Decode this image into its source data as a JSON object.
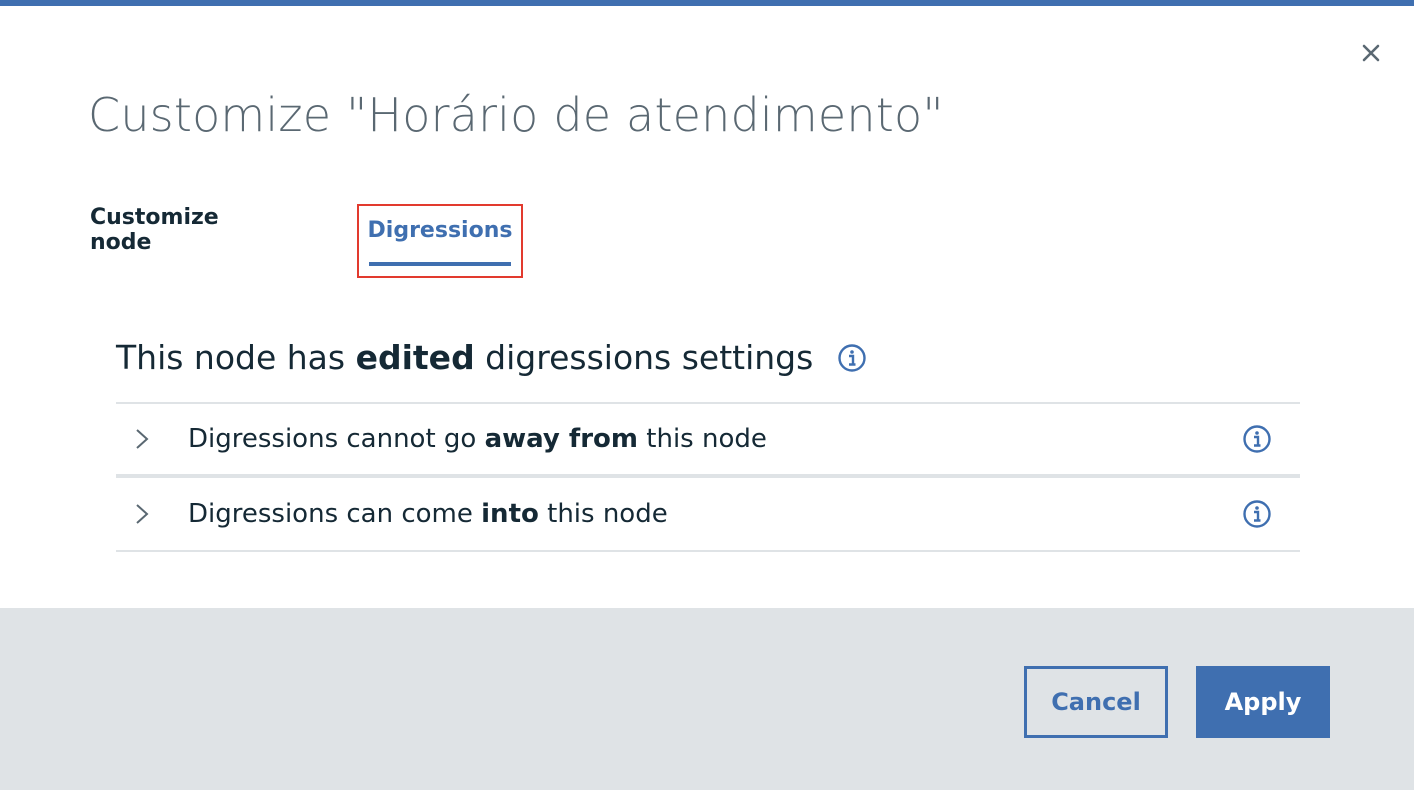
{
  "dialog": {
    "title": "Customize \"Horário de atendimento\"",
    "close_icon": "close-icon"
  },
  "tabs": [
    {
      "label": "Customize node",
      "selected": false
    },
    {
      "label": "Digressions",
      "selected": true
    }
  ],
  "digressions": {
    "heading_prefix": "This node has ",
    "heading_bold": "edited",
    "heading_suffix": " digressions settings",
    "items": [
      {
        "prefix": "Digressions cannot go ",
        "bold": "away from",
        "suffix": " this node"
      },
      {
        "prefix": "Digressions can come ",
        "bold": "into",
        "suffix": " this node"
      }
    ]
  },
  "footer": {
    "cancel_label": "Cancel",
    "apply_label": "Apply"
  },
  "colors": {
    "accent": "#3f6fb0",
    "text_dark": "#152935",
    "title_gray": "#5a6872",
    "footer_bg": "#dfe3e6",
    "highlight_red": "#e23a2e"
  }
}
